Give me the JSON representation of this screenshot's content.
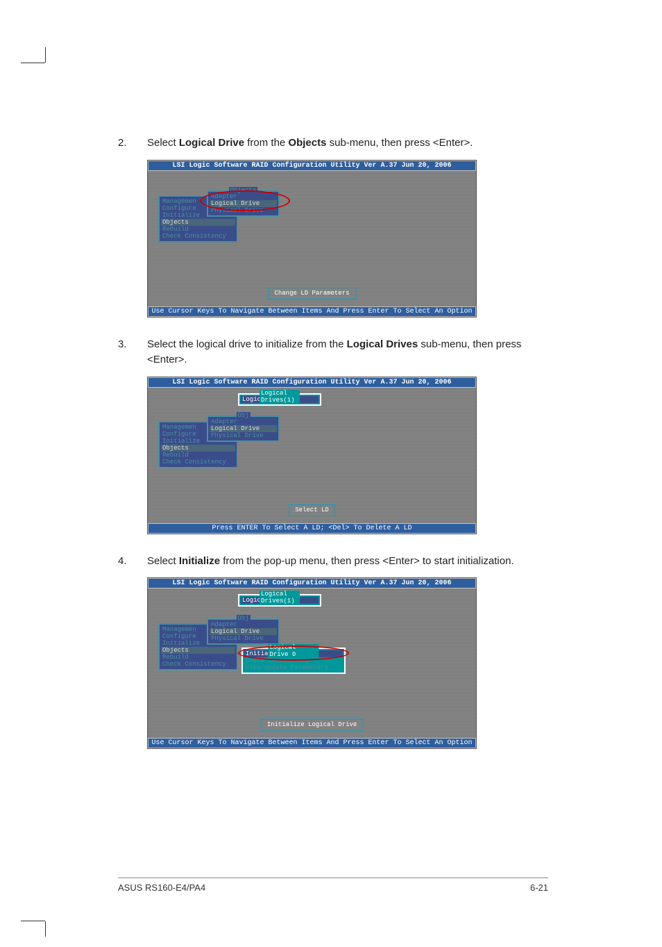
{
  "steps": {
    "s2": {
      "num": "2.",
      "text_prefix": "Select ",
      "bold1": "Logical Drive",
      "text_mid": " from the ",
      "bold2": "Objects",
      "text_suffix": " sub-menu, then press <Enter>."
    },
    "s3": {
      "num": "3.",
      "text_prefix": "Select the logical drive to initialize from the ",
      "bold1": "Logical Drives",
      "text_suffix": " sub-menu, then press <Enter>."
    },
    "s4": {
      "num": "4.",
      "text_prefix": "Select ",
      "bold1": "Initialize",
      "text_suffix": " from the pop-up menu, then press <Enter> to start initialization."
    }
  },
  "bios": {
    "header": "LSI Logic Software RAID Configuration Utility Ver A.37 Jun 20, 2006",
    "footer1": "Use Cursor Keys To Navigate Between Items And Press Enter To Select An Option",
    "footer2": "Press ENTER To Select A LD; <Del> To Delete A LD",
    "footer3": "Use Cursor Keys To Navigate Between Items And Press Enter To Select An Option",
    "main_menu": {
      "title": "Management Menu",
      "items": [
        "Configure",
        "Initialize",
        "Objects",
        "Rebuild",
        "Check Consistency"
      ]
    },
    "main_menu_label": "Managemen",
    "objects_menu": {
      "title": "Objects",
      "items": [
        "Adapter",
        "Logical Drive",
        "Physical Drive"
      ]
    },
    "objects_label": "Obj",
    "logical_drives": {
      "title": "Logical Drives(1)",
      "items": [
        "Logical Drive 0"
      ]
    },
    "popup": {
      "title": "Logical Drive 0",
      "items": [
        "Initialize",
        "Check Consistency",
        "View/Update Parameters"
      ]
    },
    "status": {
      "s1": "Change LD Parameters",
      "s2": "Select LD",
      "s3": "Initialize Logical Drive"
    }
  },
  "footer": {
    "left": "ASUS RS160-E4/PA4",
    "right": "6-21"
  }
}
